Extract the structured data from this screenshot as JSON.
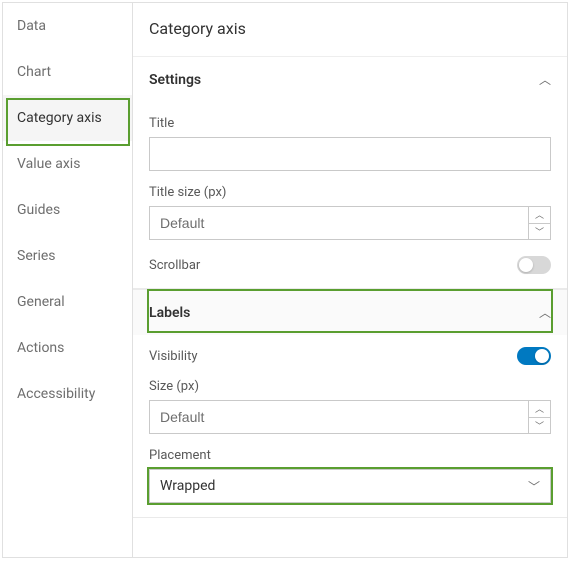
{
  "sidebar": {
    "items": [
      {
        "label": "Data"
      },
      {
        "label": "Chart"
      },
      {
        "label": "Category axis"
      },
      {
        "label": "Value axis"
      },
      {
        "label": "Guides"
      },
      {
        "label": "Series"
      },
      {
        "label": "General"
      },
      {
        "label": "Actions"
      },
      {
        "label": "Accessibility"
      }
    ],
    "active_index": 2
  },
  "page": {
    "title": "Category axis"
  },
  "settings": {
    "section_label": "Settings",
    "title_label": "Title",
    "title_value": "",
    "title_size_label": "Title size (px)",
    "title_size_value": "Default",
    "scrollbar_label": "Scrollbar",
    "scrollbar_on": false
  },
  "labels": {
    "section_label": "Labels",
    "visibility_label": "Visibility",
    "visibility_on": true,
    "size_label": "Size (px)",
    "size_value": "Default",
    "placement_label": "Placement",
    "placement_value": "Wrapped"
  }
}
